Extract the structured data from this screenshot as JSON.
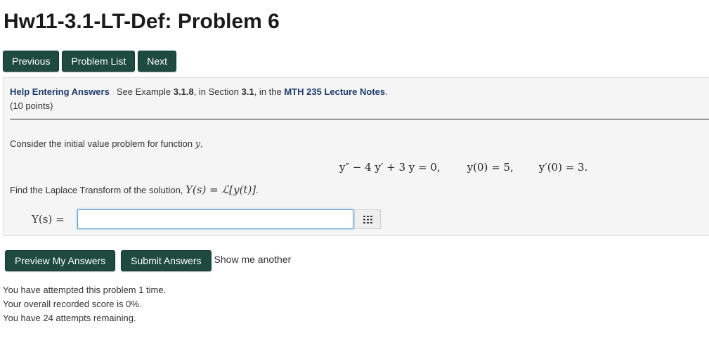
{
  "page": {
    "title": "Hw11-3.1-LT-Def: Problem 6"
  },
  "nav": {
    "previous": "Previous",
    "problem_list": "Problem List",
    "next": "Next"
  },
  "problem": {
    "help_link": "Help Entering Answers",
    "see_text": "See Example ",
    "example_ref": "3.1.8",
    "in_section_text": ", in Section ",
    "section_ref": "3.1",
    "in_the_text": ", in the ",
    "notes_ref": "MTH 235 Lecture Notes",
    "period": ".",
    "points": "(10 points)",
    "intro": "Consider the initial value problem for function ",
    "intro_var": "y",
    "intro_end": ",",
    "eq_ode": "y″ − 4 y′ + 3 y = 0,",
    "eq_ic1": "y(0) = 5,",
    "eq_ic2": "y′(0) = 3.",
    "find_text": "Find the Laplace Transform of the solution, ",
    "find_math": "Y(s) = ℒ[y(t)]",
    "find_end": ".",
    "answer_label": "Y(s) =",
    "answer_value": "",
    "equation_editor_icon": "grid-icon"
  },
  "actions": {
    "preview": "Preview My Answers",
    "submit": "Submit Answers",
    "show_another": "Show me another"
  },
  "status": {
    "attempted": "You have attempted this problem 1 time.",
    "score": "Your overall recorded score is 0%.",
    "remaining": "You have 24 attempts remaining."
  },
  "colors": {
    "button_bg": "#1e4a40",
    "panel_bg": "#f5f5f5",
    "link": "#1d3b6b",
    "input_focus": "#5aa0d8"
  }
}
